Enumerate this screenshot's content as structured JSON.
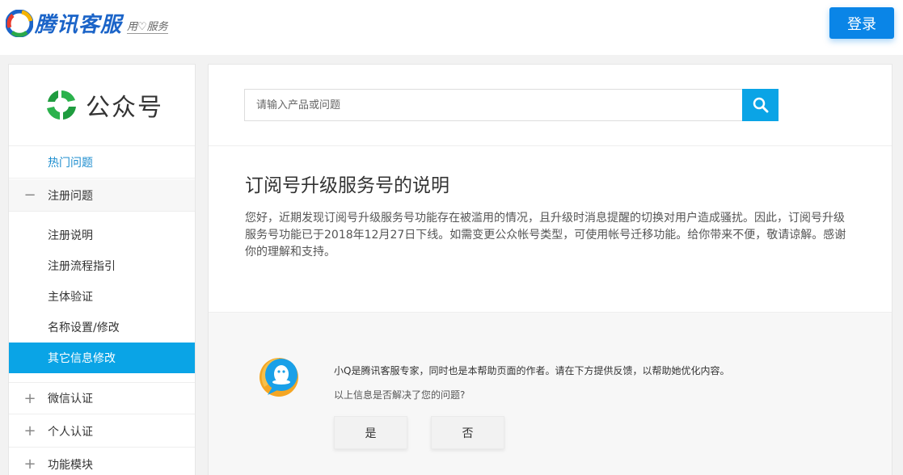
{
  "header": {
    "brand": "腾讯客服",
    "slogan": "用♡服务",
    "login_label": "登录",
    "brand_color": "#1b64c8",
    "accent_color": "#0a85e7"
  },
  "sidebar": {
    "product_name": "公众号",
    "hot_label": "热门问题",
    "groups": [
      {
        "sign": "−",
        "label": "注册问题"
      },
      {
        "sign": "+",
        "label": "微信认证"
      },
      {
        "sign": "+",
        "label": "个人认证"
      },
      {
        "sign": "+",
        "label": "功能模块"
      }
    ],
    "sub_items": [
      {
        "label": "注册说明"
      },
      {
        "label": "注册流程指引"
      },
      {
        "label": "主体验证"
      },
      {
        "label": "名称设置/修改"
      },
      {
        "label": "其它信息修改"
      }
    ],
    "active_color": "#0aa4e6"
  },
  "search": {
    "placeholder": "请输入产品或问题"
  },
  "article": {
    "title": "订阅号升级服务号的说明",
    "body": "您好，近期发现订阅号升级服务号功能存在被滥用的情况，且升级时消息提醒的切换对用户造成骚扰。因此，订阅号升级服务号功能已于2018年12月27日下线。如需变更公众帐号类型，可使用帐号迁移功能。给你带来不便，敬请谅解。感谢你的理解和支持。"
  },
  "feedback": {
    "intro": "小Q是腾讯客服专家，同时也是本帮助页面的作者。请在下方提供反馈，以帮助她优化内容。",
    "question": "以上信息是否解决了您的问题?",
    "yes_label": "是",
    "no_label": "否"
  }
}
